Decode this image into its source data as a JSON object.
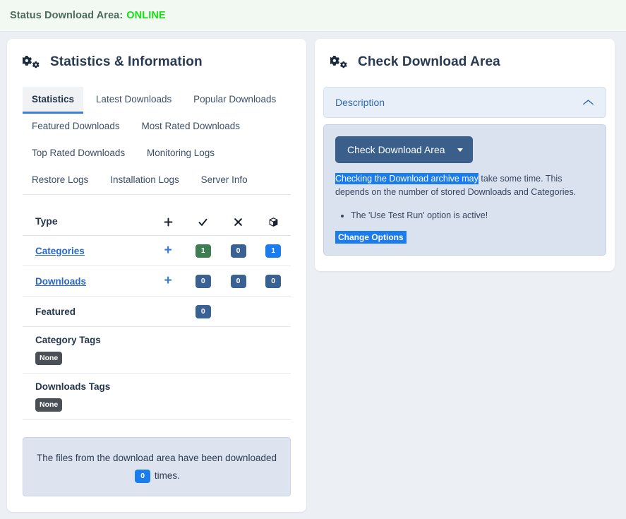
{
  "status_bar": {
    "label": "Status Download Area:",
    "state": "ONLINE",
    "state_color": "#15e015"
  },
  "left_panel": {
    "icon": "cogs-icon",
    "title": "Statistics & Information",
    "tabs": [
      {
        "label": "Statistics",
        "active": true
      },
      {
        "label": "Latest Downloads",
        "active": false
      },
      {
        "label": "Popular Downloads",
        "active": false
      },
      {
        "label": "Featured Downloads",
        "active": false
      },
      {
        "label": "Most Rated Downloads",
        "active": false
      },
      {
        "label": "Top Rated Downloads",
        "active": false
      },
      {
        "label": "Monitoring Logs",
        "active": false
      },
      {
        "label": "Restore Logs",
        "active": false
      },
      {
        "label": "Installation Logs",
        "active": false
      },
      {
        "label": "Server Info",
        "active": false
      }
    ],
    "table": {
      "headers": {
        "type": "Type",
        "col_add": "plus-icon",
        "col_active": "check-icon",
        "col_inactive": "times-icon",
        "col_archive": "box-icon"
      },
      "rows": [
        {
          "name": "Categories",
          "is_link": true,
          "add": "+",
          "active": "1",
          "inactive": "0",
          "archive": "1",
          "active_color": "#3f7d52",
          "inactive_color": "#3a6193",
          "archive_color": "#1b7ced"
        },
        {
          "name": "Downloads",
          "is_link": true,
          "add": "+",
          "active": "0",
          "inactive": "0",
          "archive": "0",
          "active_color": "#3a6193",
          "inactive_color": "#3a6193",
          "archive_color": "#3a6193"
        }
      ],
      "featured": {
        "label": "Featured",
        "value": "0",
        "color": "#3a6193"
      },
      "category_tags": {
        "label": "Category Tags",
        "value": "None"
      },
      "downloads_tags": {
        "label": "Downloads Tags",
        "value": "None"
      }
    },
    "info_box": {
      "text_before": "The files from the download area have been downloaded",
      "count": "0",
      "text_after": "times."
    }
  },
  "right_panel": {
    "icon": "cogs-icon",
    "title": "Check Download Area",
    "accordion": {
      "header": "Description",
      "toggle_icon": "chevron-up-icon",
      "button": {
        "label": "Check Download Area",
        "dropdown_icon": "caret-down-icon"
      },
      "description_selected": "Checking the Download archive may",
      "description_rest": " take some time. This depends on the number of stored Downloads and Categories.",
      "bullets": [
        "The 'Use Test Run' option is active!"
      ],
      "options_link": "Change Options"
    }
  }
}
